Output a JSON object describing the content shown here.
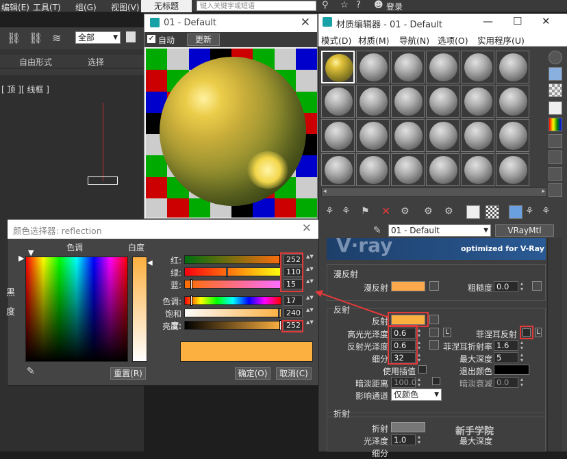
{
  "app": {
    "menus": [
      "编辑(E)",
      "工具(T)",
      "组(G)",
      "视图(V)"
    ],
    "doc_title": "无标题",
    "search_placeholder": "键入关键字或短语",
    "login": "登录",
    "selection_filter": "全部",
    "ribbon": [
      "自由形式",
      "选择"
    ],
    "viewport_label": "[ 顶 ][ 线框 ]"
  },
  "preview_window": {
    "title": "01 - Default",
    "auto_label": "自动",
    "update_button": "更新"
  },
  "material_editor": {
    "title": "材质编辑器 - 01 - Default",
    "menus": [
      "模式(D)",
      "材质(M)",
      "导航(N)",
      "选项(O)",
      "实用程序(U)"
    ],
    "material_name": "01 - Default",
    "material_type": "VRayMtl",
    "banner_text": "optimized for V-Ray",
    "diffuse_section": {
      "title": "漫反射",
      "diffuse_label": "漫反射",
      "roughness_label": "粗糙度",
      "roughness_value": "0.0"
    },
    "reflection_section": {
      "title": "反射",
      "reflect_label": "反射",
      "hilight_gloss_label": "高光光泽度",
      "hilight_gloss_value": "0.6",
      "l_label": "L",
      "fresnel_label": "菲涅耳反射",
      "refl_gloss_label": "反射光泽度",
      "refl_gloss_value": "0.6",
      "fresnel_ior_label": "菲涅耳折射率",
      "fresnel_ior_value": "1.6",
      "subdivs_label": "细分",
      "subdivs_value": "32",
      "max_depth_label": "最大深度",
      "max_depth_value": "5",
      "use_interp_label": "使用插值",
      "exit_color_label": "退出颜色",
      "dim_distance_label": "暗淡距离",
      "dim_distance_value": "100.0",
      "dim_falloff_label": "暗淡衰减",
      "dim_falloff_value": "0.0",
      "affect_channels_label": "影响通道",
      "affect_channels_value": "仅颜色"
    },
    "refraction_section": {
      "title": "折射",
      "refract_label": "折射",
      "gloss_label": "光泽度",
      "gloss_value": "1.0",
      "max_depth_label": "最大深度",
      "subdivs_label": "细分",
      "watermark": "新手学院"
    }
  },
  "color_picker": {
    "title": "颜色选择器: reflection",
    "hue_header": "色调",
    "whiteness_header": "白度",
    "blackness_label": "黑",
    "degree_label": "度",
    "rows": [
      {
        "label": "红:",
        "value": "252"
      },
      {
        "label": "绿:",
        "value": "110"
      },
      {
        "label": "蓝:",
        "value": "15"
      },
      {
        "label": "色调:",
        "value": "17"
      },
      {
        "label": "饱和度:",
        "value": "240"
      },
      {
        "label": "亮度:",
        "value": "252"
      }
    ],
    "reset_button": "重置(R)",
    "ok_button": "确定(O)",
    "cancel_button": "取消(C)",
    "swatch_color": "#fcb040"
  },
  "colors": {
    "accent_red": "#e23a3a",
    "reflect_swatch": "#fcb040",
    "diffuse_swatch": "#fba94a"
  }
}
